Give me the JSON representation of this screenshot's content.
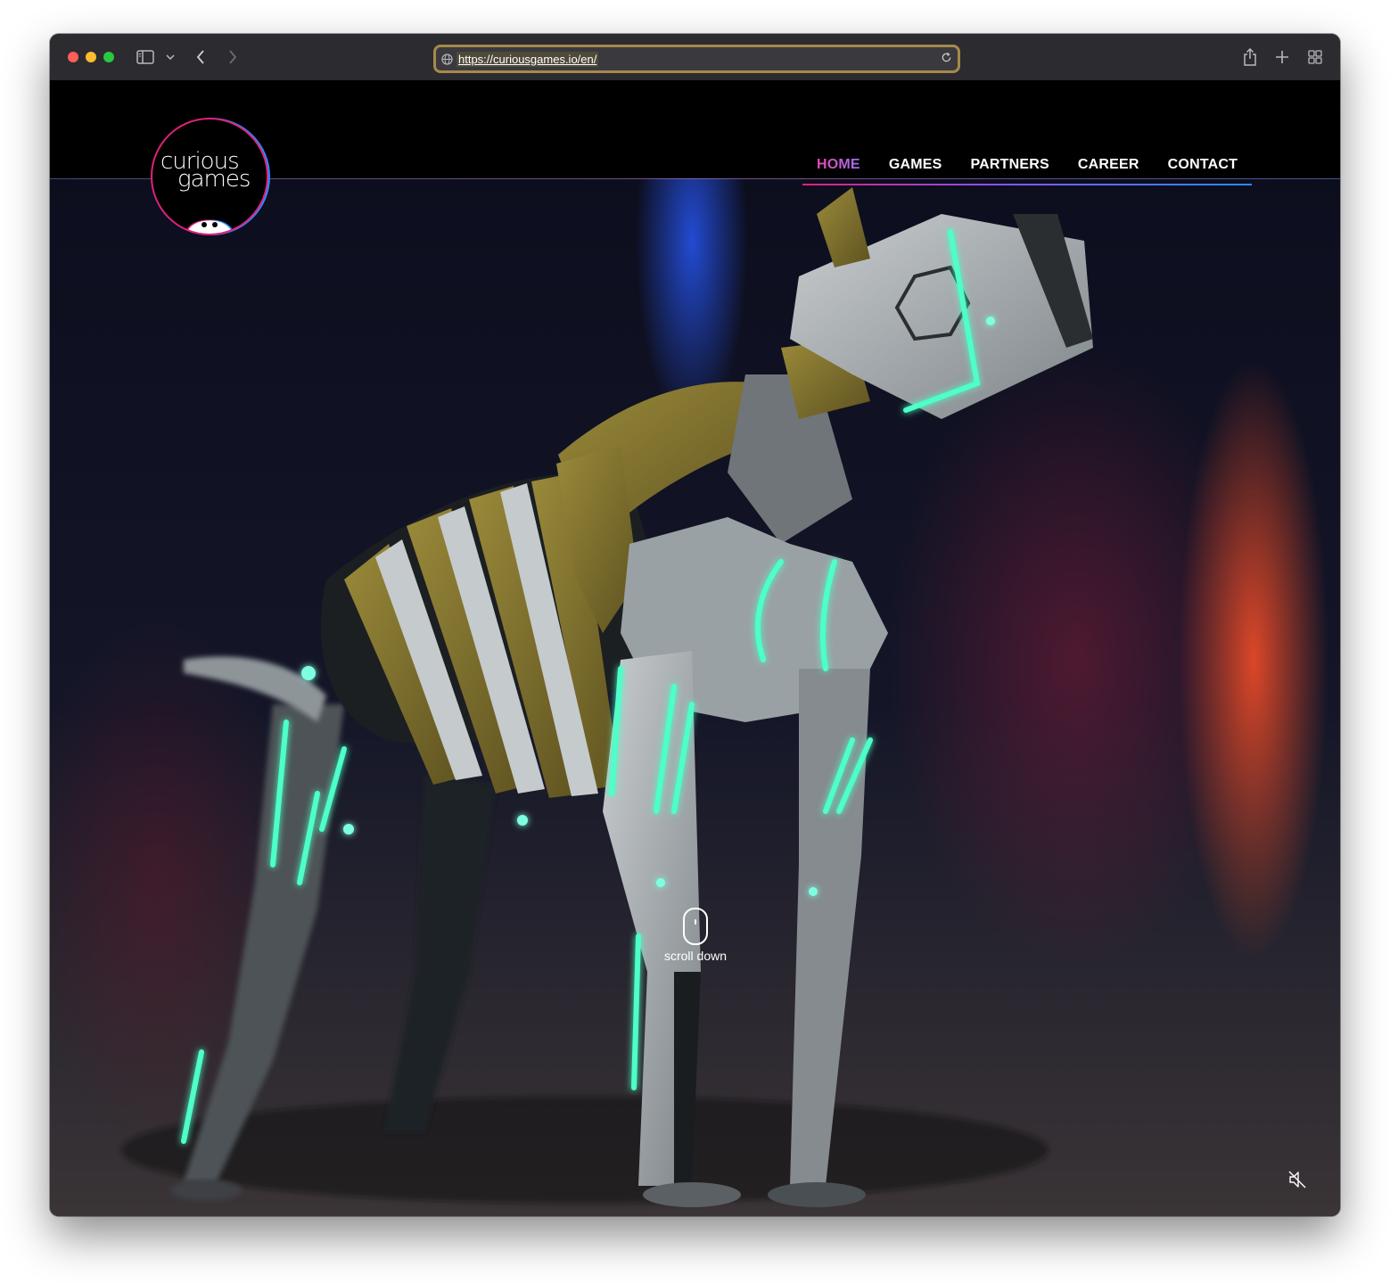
{
  "browser": {
    "url": "https://curiousgames.io/en/"
  },
  "logo": {
    "line1": "curious",
    "line2": "games"
  },
  "nav": {
    "items": [
      {
        "label": "HOME",
        "active": true
      },
      {
        "label": "GAMES",
        "active": false
      },
      {
        "label": "PARTNERS",
        "active": false
      },
      {
        "label": "CAREER",
        "active": false
      },
      {
        "label": "CONTACT",
        "active": false
      }
    ]
  },
  "hero": {
    "scroll_label": "scroll down",
    "mute_icon": "speaker-muted-icon"
  },
  "colors": {
    "accent_pink": "#ff3aa0",
    "accent_blue": "#2a8cff",
    "glow_teal": "#4dffc8"
  }
}
